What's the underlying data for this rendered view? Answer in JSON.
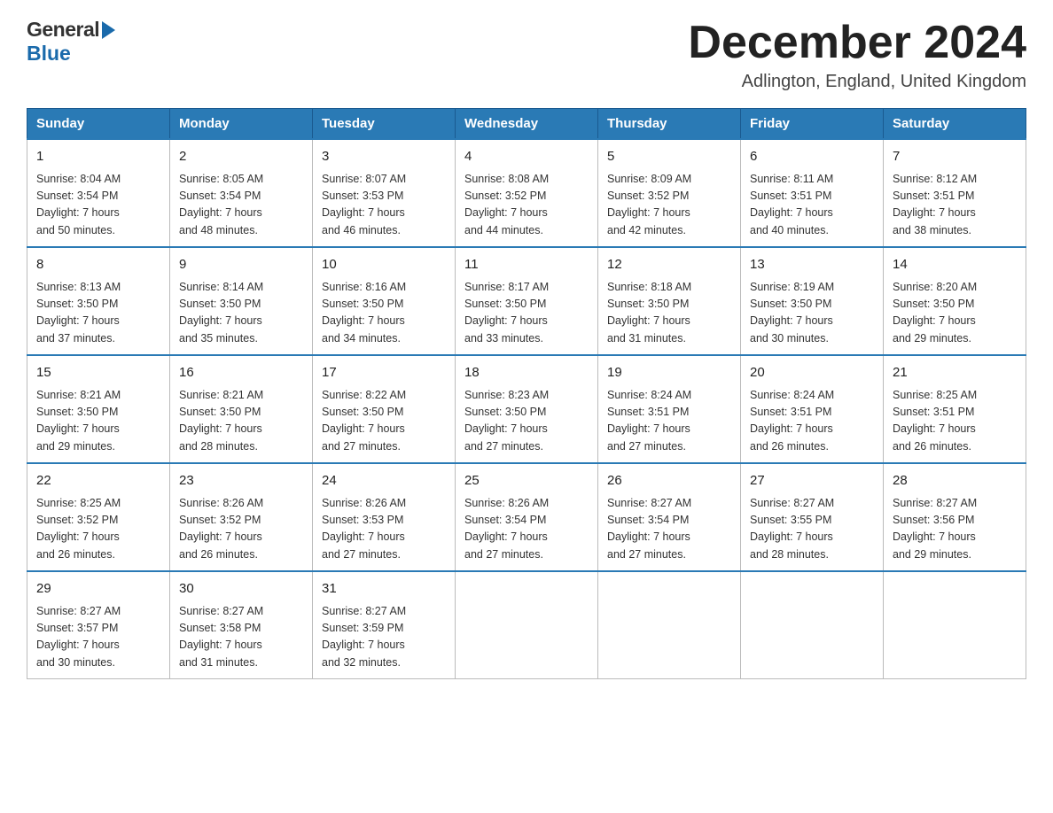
{
  "logo": {
    "general": "General",
    "blue": "Blue"
  },
  "header": {
    "month": "December 2024",
    "location": "Adlington, England, United Kingdom"
  },
  "days_of_week": [
    "Sunday",
    "Monday",
    "Tuesday",
    "Wednesday",
    "Thursday",
    "Friday",
    "Saturday"
  ],
  "weeks": [
    [
      {
        "day": "1",
        "sunrise": "8:04 AM",
        "sunset": "3:54 PM",
        "daylight": "7 hours and 50 minutes."
      },
      {
        "day": "2",
        "sunrise": "8:05 AM",
        "sunset": "3:54 PM",
        "daylight": "7 hours and 48 minutes."
      },
      {
        "day": "3",
        "sunrise": "8:07 AM",
        "sunset": "3:53 PM",
        "daylight": "7 hours and 46 minutes."
      },
      {
        "day": "4",
        "sunrise": "8:08 AM",
        "sunset": "3:52 PM",
        "daylight": "7 hours and 44 minutes."
      },
      {
        "day": "5",
        "sunrise": "8:09 AM",
        "sunset": "3:52 PM",
        "daylight": "7 hours and 42 minutes."
      },
      {
        "day": "6",
        "sunrise": "8:11 AM",
        "sunset": "3:51 PM",
        "daylight": "7 hours and 40 minutes."
      },
      {
        "day": "7",
        "sunrise": "8:12 AM",
        "sunset": "3:51 PM",
        "daylight": "7 hours and 38 minutes."
      }
    ],
    [
      {
        "day": "8",
        "sunrise": "8:13 AM",
        "sunset": "3:50 PM",
        "daylight": "7 hours and 37 minutes."
      },
      {
        "day": "9",
        "sunrise": "8:14 AM",
        "sunset": "3:50 PM",
        "daylight": "7 hours and 35 minutes."
      },
      {
        "day": "10",
        "sunrise": "8:16 AM",
        "sunset": "3:50 PM",
        "daylight": "7 hours and 34 minutes."
      },
      {
        "day": "11",
        "sunrise": "8:17 AM",
        "sunset": "3:50 PM",
        "daylight": "7 hours and 33 minutes."
      },
      {
        "day": "12",
        "sunrise": "8:18 AM",
        "sunset": "3:50 PM",
        "daylight": "7 hours and 31 minutes."
      },
      {
        "day": "13",
        "sunrise": "8:19 AM",
        "sunset": "3:50 PM",
        "daylight": "7 hours and 30 minutes."
      },
      {
        "day": "14",
        "sunrise": "8:20 AM",
        "sunset": "3:50 PM",
        "daylight": "7 hours and 29 minutes."
      }
    ],
    [
      {
        "day": "15",
        "sunrise": "8:21 AM",
        "sunset": "3:50 PM",
        "daylight": "7 hours and 29 minutes."
      },
      {
        "day": "16",
        "sunrise": "8:21 AM",
        "sunset": "3:50 PM",
        "daylight": "7 hours and 28 minutes."
      },
      {
        "day": "17",
        "sunrise": "8:22 AM",
        "sunset": "3:50 PM",
        "daylight": "7 hours and 27 minutes."
      },
      {
        "day": "18",
        "sunrise": "8:23 AM",
        "sunset": "3:50 PM",
        "daylight": "7 hours and 27 minutes."
      },
      {
        "day": "19",
        "sunrise": "8:24 AM",
        "sunset": "3:51 PM",
        "daylight": "7 hours and 27 minutes."
      },
      {
        "day": "20",
        "sunrise": "8:24 AM",
        "sunset": "3:51 PM",
        "daylight": "7 hours and 26 minutes."
      },
      {
        "day": "21",
        "sunrise": "8:25 AM",
        "sunset": "3:51 PM",
        "daylight": "7 hours and 26 minutes."
      }
    ],
    [
      {
        "day": "22",
        "sunrise": "8:25 AM",
        "sunset": "3:52 PM",
        "daylight": "7 hours and 26 minutes."
      },
      {
        "day": "23",
        "sunrise": "8:26 AM",
        "sunset": "3:52 PM",
        "daylight": "7 hours and 26 minutes."
      },
      {
        "day": "24",
        "sunrise": "8:26 AM",
        "sunset": "3:53 PM",
        "daylight": "7 hours and 27 minutes."
      },
      {
        "day": "25",
        "sunrise": "8:26 AM",
        "sunset": "3:54 PM",
        "daylight": "7 hours and 27 minutes."
      },
      {
        "day": "26",
        "sunrise": "8:27 AM",
        "sunset": "3:54 PM",
        "daylight": "7 hours and 27 minutes."
      },
      {
        "day": "27",
        "sunrise": "8:27 AM",
        "sunset": "3:55 PM",
        "daylight": "7 hours and 28 minutes."
      },
      {
        "day": "28",
        "sunrise": "8:27 AM",
        "sunset": "3:56 PM",
        "daylight": "7 hours and 29 minutes."
      }
    ],
    [
      {
        "day": "29",
        "sunrise": "8:27 AM",
        "sunset": "3:57 PM",
        "daylight": "7 hours and 30 minutes."
      },
      {
        "day": "30",
        "sunrise": "8:27 AM",
        "sunset": "3:58 PM",
        "daylight": "7 hours and 31 minutes."
      },
      {
        "day": "31",
        "sunrise": "8:27 AM",
        "sunset": "3:59 PM",
        "daylight": "7 hours and 32 minutes."
      },
      null,
      null,
      null,
      null
    ]
  ],
  "labels": {
    "sunrise": "Sunrise:",
    "sunset": "Sunset:",
    "daylight": "Daylight:"
  }
}
